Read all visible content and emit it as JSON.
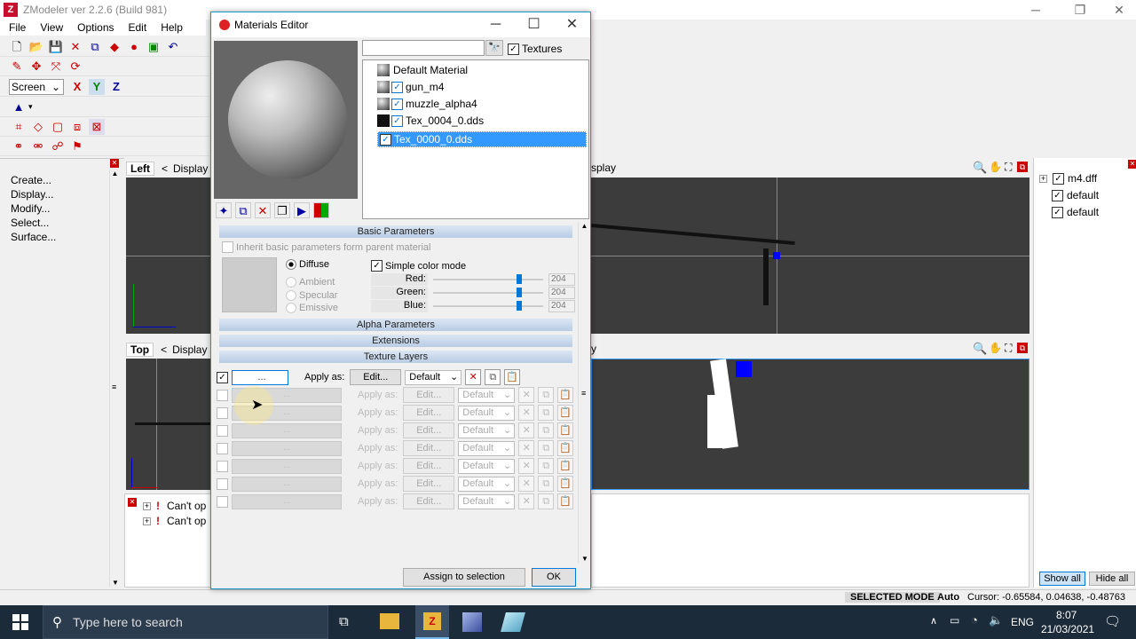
{
  "app": {
    "title": "ZModeler ver 2.2.6 (Build 981)",
    "icon_letter": "Z",
    "menu": [
      "File",
      "View",
      "Options",
      "Edit",
      "Help"
    ]
  },
  "toolbar": {
    "mode_select": "Screen",
    "axis_x": "X",
    "axis_y": "Y",
    "axis_z": "Z"
  },
  "left_panel": {
    "items": [
      "Create...",
      "Display...",
      "Modify...",
      "Select...",
      "Surface..."
    ]
  },
  "viewports": {
    "left_label": "Left",
    "top_label": "Top",
    "display_label": "Display",
    "nav_arrow": "<",
    "right_top_label": "splay",
    "right_bottom_label": "y"
  },
  "log": {
    "entries": [
      "Can't op",
      "Can't op"
    ]
  },
  "hierarchy": {
    "items": [
      "m4.dff",
      "default",
      "default"
    ],
    "show_all": "Show all",
    "hide_all": "Hide all"
  },
  "status": {
    "mode": "SELECTED MODE",
    "auto": "Auto",
    "cursor": "Cursor: -0.65584, 0.04638, -0.48763"
  },
  "dialog": {
    "title": "Materials Editor",
    "search_value": "",
    "textures_label": "Textures",
    "materials": [
      {
        "name": "Default Material",
        "checked": false,
        "selected": false
      },
      {
        "name": "gun_m4",
        "checked": true,
        "selected": false
      },
      {
        "name": "muzzle_alpha4",
        "checked": true,
        "selected": false
      },
      {
        "name": "Tex_0004_0.dds",
        "checked": true,
        "selected": false
      },
      {
        "name": "Tex_0000_0.dds",
        "checked": true,
        "selected": true
      }
    ],
    "basic_params_title": "Basic Parameters",
    "inherit_label": "Inherit basic parameters form parent material",
    "diffuse": "Diffuse",
    "ambient": "Ambient",
    "specular": "Specular",
    "emissive": "Emissive",
    "simple_color_mode": "Simple color mode",
    "red_label": "Red:",
    "green_label": "Green:",
    "blue_label": "Blue:",
    "red_value": "204",
    "green_value": "204",
    "blue_value": "204",
    "alpha_params_title": "Alpha Parameters",
    "extensions_title": "Extensions",
    "texture_layers_title": "Texture Layers",
    "layer_slot_text": "...",
    "apply_as": "Apply as:",
    "edit_btn": "Edit...",
    "default_opt": "Default",
    "assign_btn": "Assign to selection",
    "ok_btn": "OK"
  },
  "taskbar": {
    "search_placeholder": "Type here to search",
    "lang": "ENG",
    "time": "8:07",
    "date": "21/03/2021"
  }
}
